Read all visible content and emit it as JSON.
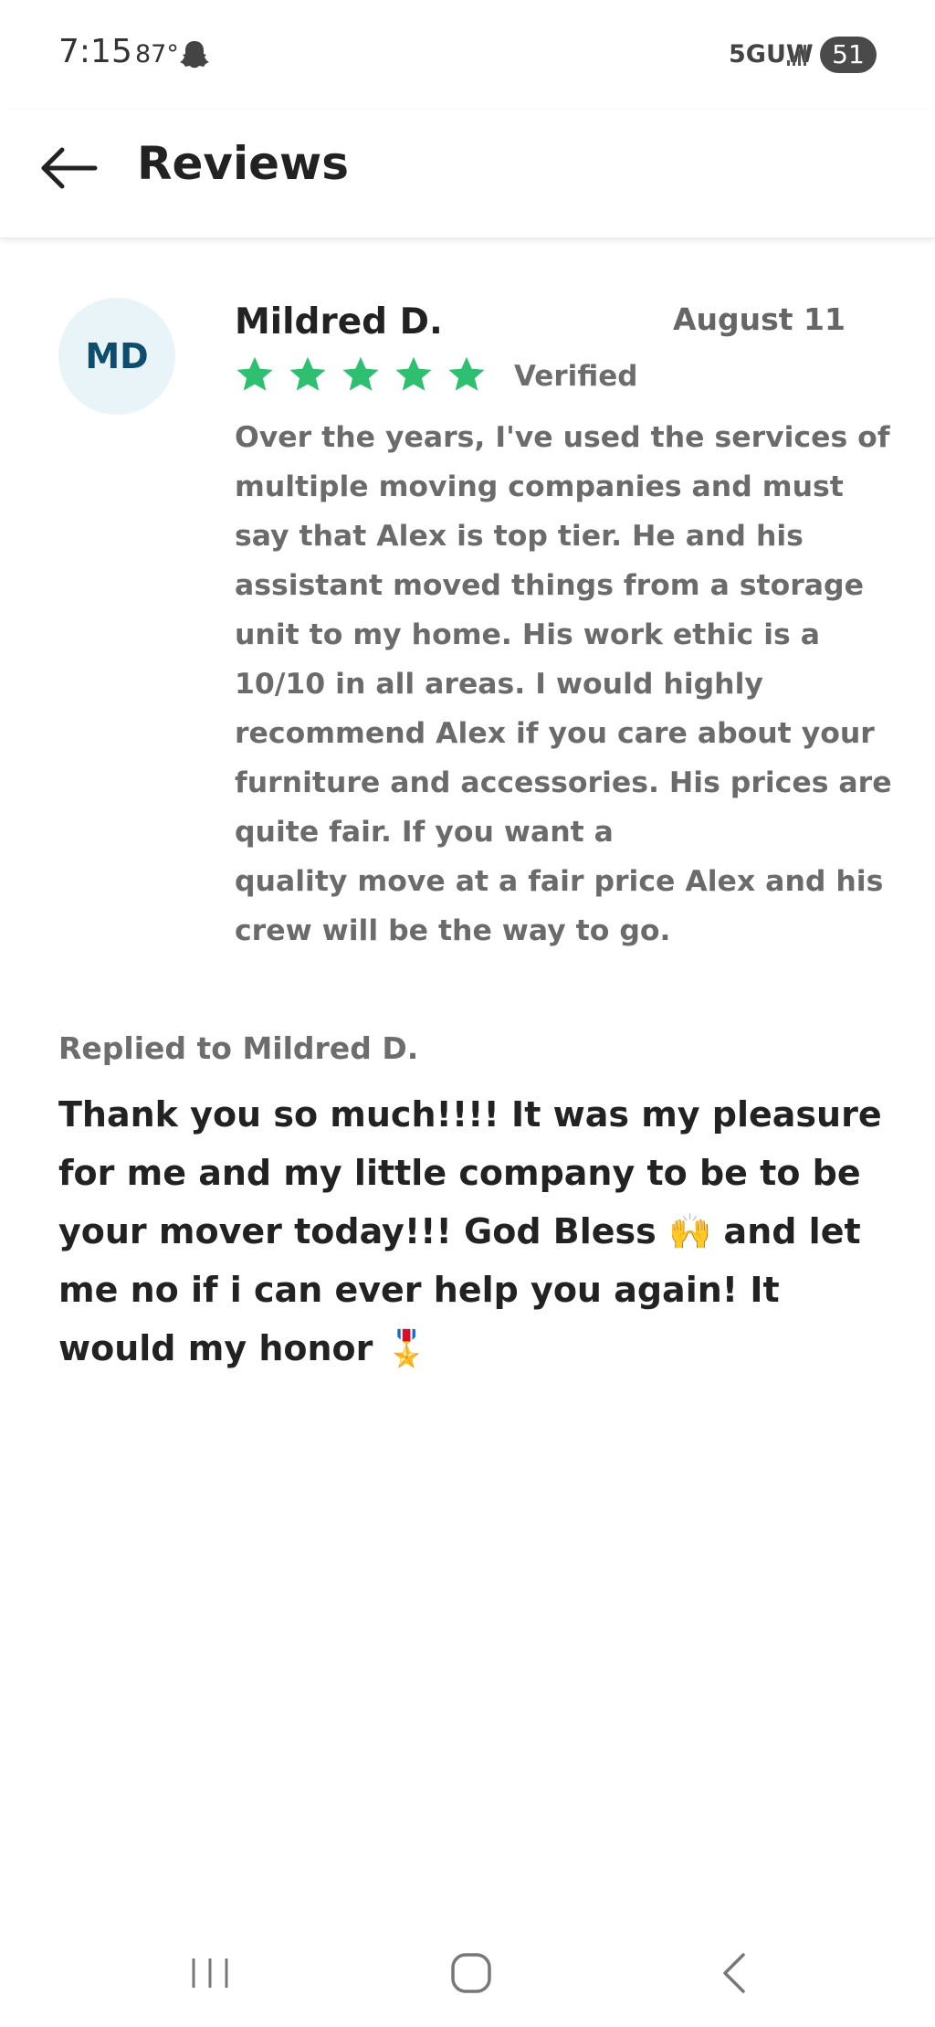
{
  "status_bar": {
    "time": "7:15",
    "temperature": "87°",
    "notification_icon": "snapchat-ghost-icon",
    "network": "5GUW",
    "signal_icon": "signal-bars-icon",
    "battery": "51"
  },
  "header": {
    "back_icon": "arrow-left-icon",
    "title": "Reviews"
  },
  "review": {
    "avatar_initials": "MD",
    "reviewer_name": "Mildred D.",
    "date": "August 11",
    "rating": 5,
    "rating_max": 5,
    "star_color": "#2fbf71",
    "verified_label": "Verified",
    "text": "Over the years, I've used the services of multiple moving companies and must say that Alex is top tier. He and his assistant moved things from a storage unit to my home. His work ethic is a 10/10 in all areas. I would highly recommend Alex if you care about your furniture and accessories. His prices are quite fair. If you want a\n quality move at a fair price Alex and his crew will be the way to go."
  },
  "reply": {
    "label": "Replied to Mildred D.",
    "text": "Thank you so much!!!! It was my pleasure for me and my little company to be to be your mover today!!! God Bless 🙌 and let me no if i can ever help you again! It would my honor 🎖️"
  },
  "nav_bar": {
    "recents_icon": "recent-apps-icon",
    "home_icon": "home-icon",
    "back_icon": "back-chevron-icon"
  },
  "colors": {
    "accent_star": "#2fbf71",
    "avatar_bg": "#e8f4f8",
    "avatar_text": "#0d4d6e"
  }
}
